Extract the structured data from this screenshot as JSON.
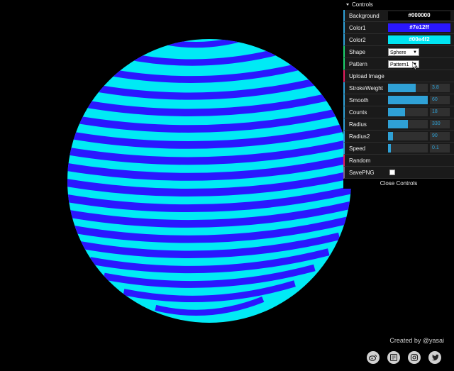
{
  "gui": {
    "header": "Controls",
    "close_label": "Close Controls",
    "background": {
      "label": "Background",
      "value": "#000000",
      "color": "#000000"
    },
    "color1": {
      "label": "Color1",
      "value": "#7e12ff",
      "color": "#2a17ff"
    },
    "color2": {
      "label": "Color2",
      "value": "#00e4f2",
      "color": "#00e4f2"
    },
    "shape": {
      "label": "Shape",
      "value": "Sphere"
    },
    "pattern": {
      "label": "Pattern",
      "value": "Pattern1"
    },
    "upload_label": "Upload Image",
    "stroke_weight": {
      "label": "StrokeWeight",
      "value": "3.8",
      "fraction": 0.7
    },
    "smooth": {
      "label": "Smooth",
      "value": "60",
      "fraction": 1.0
    },
    "counts": {
      "label": "Counts",
      "value": "18",
      "fraction": 0.42
    },
    "radius": {
      "label": "Radius",
      "value": "330",
      "fraction": 0.5
    },
    "radius2": {
      "label": "Radius2",
      "value": "90",
      "fraction": 0.12
    },
    "speed": {
      "label": "Speed",
      "value": "0.1",
      "fraction": 0.08
    },
    "random_label": "Random",
    "savepng": {
      "label": "SavePNG",
      "checked": false
    }
  },
  "credit": "Created by @yasai",
  "socials": [
    "weibo-icon",
    "wechat-icon",
    "instagram-icon",
    "twitter-icon"
  ],
  "sphere": {
    "stripe_color": "#2a17ff",
    "base_color": "#00eaf5",
    "stripe_count": 18
  }
}
